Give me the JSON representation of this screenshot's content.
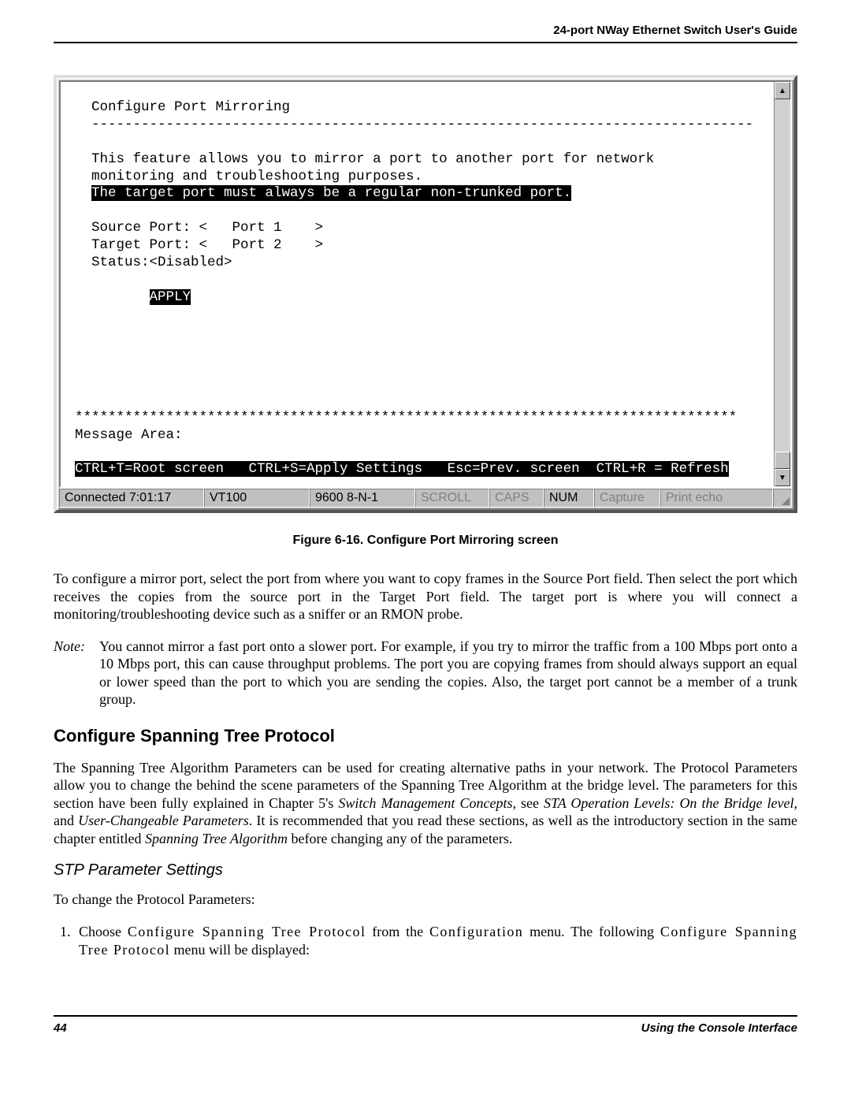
{
  "header": {
    "title": "24-port NWay Ethernet Switch User's Guide"
  },
  "terminal": {
    "title": "Configure Port Mirroring",
    "dashes": "--------------------------------------------------------------------------------",
    "desc1": "This feature allows you to mirror a port to another port for network",
    "desc2": "monitoring and troubleshooting purposes.",
    "warn": "The target port must always be a regular non-trunked port.",
    "src_label": "Source Port: <   Port 1    >",
    "tgt_label": "Target Port: <   Port 2    >",
    "status_label": "Status:<Disabled>",
    "apply": "APPLY",
    "stars": "********************************************************************************",
    "msg_area": "Message Area:",
    "help": "CTRL+T=Root screen   CTRL+S=Apply Settings   Esc=Prev. screen  CTRL+R = Refresh"
  },
  "statusbar": {
    "conn": "Connected 7:01:17",
    "emu": "VT100",
    "line": "9600 8-N-1",
    "scroll": "SCROLL",
    "caps": "CAPS",
    "num": "NUM",
    "capture": "Capture",
    "echo": "Print echo"
  },
  "caption": "Figure 6-16.  Configure Port Mirroring screen",
  "body": {
    "p1": "To configure a mirror port, select the port from where you want to copy frames in the Source Port field. Then select the port which receives the copies from the source port in the Target Port field. The target port is where you will connect a monitoring/troubleshooting device such as a sniffer or an RMON probe.",
    "note_label": "Note:",
    "note": "You cannot mirror a fast port onto a slower port. For example, if you try to mirror the traffic from a 100 Mbps port onto a 10 Mbps port, this can cause throughput problems. The port you are copying frames from should always support an equal or lower speed than the port to which you are sending the copies. Also, the target port cannot be a member of a trunk group.",
    "h2": "Configure Spanning Tree Protocol",
    "p2a": "The Spanning Tree Algorithm Parameters can be used for creating alternative paths in your network. The Protocol Parameters allow you to change the behind the scene parameters of the Spanning Tree Algorithm at the bridge level. The parameters for this section have been fully explained in Chapter 5's ",
    "p2i1": "Switch Management Concepts",
    "p2b": ", see ",
    "p2i2": "STA Operation Levels: On the Bridge level",
    "p2c": ", and ",
    "p2i3": "User-Changeable Parameters",
    "p2d": ". It is recommended that you read these sections, as well as the introductory section in the same chapter entitled ",
    "p2i4": "Spanning Tree Algorithm",
    "p2e": " before changing any of the parameters.",
    "h3": "STP Parameter Settings",
    "p3": "To change the Protocol Parameters:",
    "step1a": "Choose ",
    "step1i1": "Configure Spanning Tree Protocol",
    "step1b": " from the ",
    "step1i2": "Configuration",
    "step1c": " menu. The following ",
    "step1i3": "Configure Spanning Tree Protocol",
    "step1d": " menu will be displayed:"
  },
  "footer": {
    "page": "44",
    "section": "Using the Console Interface"
  }
}
